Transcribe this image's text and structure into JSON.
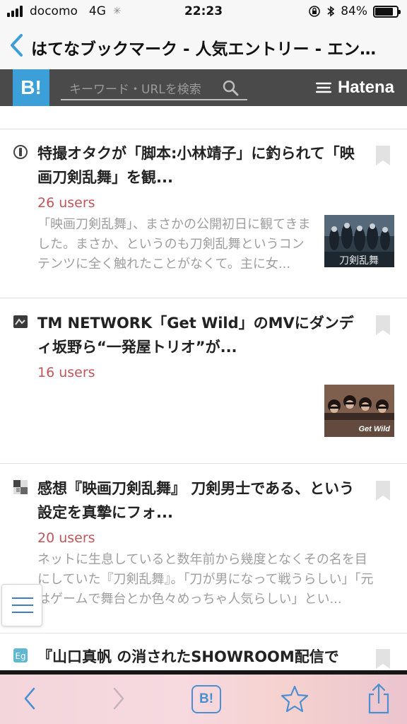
{
  "status_bar": {
    "carrier": "docomo",
    "network": "4G",
    "time": "22:23",
    "battery": "84%",
    "battery_level": 0.84
  },
  "nav": {
    "title": "はてなブックマーク - 人気エントリー - エン…"
  },
  "header": {
    "logo": "B!",
    "search_placeholder": "キーワード・URLを検索",
    "brand": "Hatena",
    "colors": {
      "bar": "#4a4a4a",
      "logo_bg": "#3d9fd8"
    }
  },
  "entries": [
    {
      "title": "特撮オタクが「脚本:小林靖子」に釣られて「映画刀剣乱舞」を観...",
      "users": "26 users",
      "description": "「映画刀剣乱舞」、まさかの公開初日に観てきました。まさか、というのも刀剣乱舞というコンテンツに全く触れたことがなくて。主に女...",
      "thumb_caption": "刀剣乱舞",
      "favicon": "info-circle-icon"
    },
    {
      "title": "TM NETWORK「Get Wild」のMVにダンディ坂野ら“一発屋トリオ”が...",
      "users": "16 users",
      "description": "",
      "thumb_caption": "Get Wild",
      "favicon": "site-icon"
    },
    {
      "title": "感想『映画刀剣乱舞』 刀剣男士である、という設定を真摯にフォ...",
      "users": "20 users",
      "description": "ネットに生息していると数年前から幾度となくその名を目にしていた『刀剣乱舞』。「刀が男になって戦うらしい」「元はゲームで舞台とか色々めっちゃ人気らしい」とい...",
      "thumb_caption": "",
      "favicon": "blog-icon"
    },
    {
      "title": "『山口真帆 の消されたSHOWROOM配信で",
      "users": "",
      "description": "",
      "thumb_caption": "",
      "favicon": "site-icon"
    }
  ],
  "toolbar": {
    "back": "back-icon",
    "forward": "forward-icon",
    "hatena": "B!",
    "favorite": "star-icon",
    "share": "share-icon"
  },
  "colors": {
    "users": "#c0565a",
    "accent": "#3d9fd8"
  }
}
